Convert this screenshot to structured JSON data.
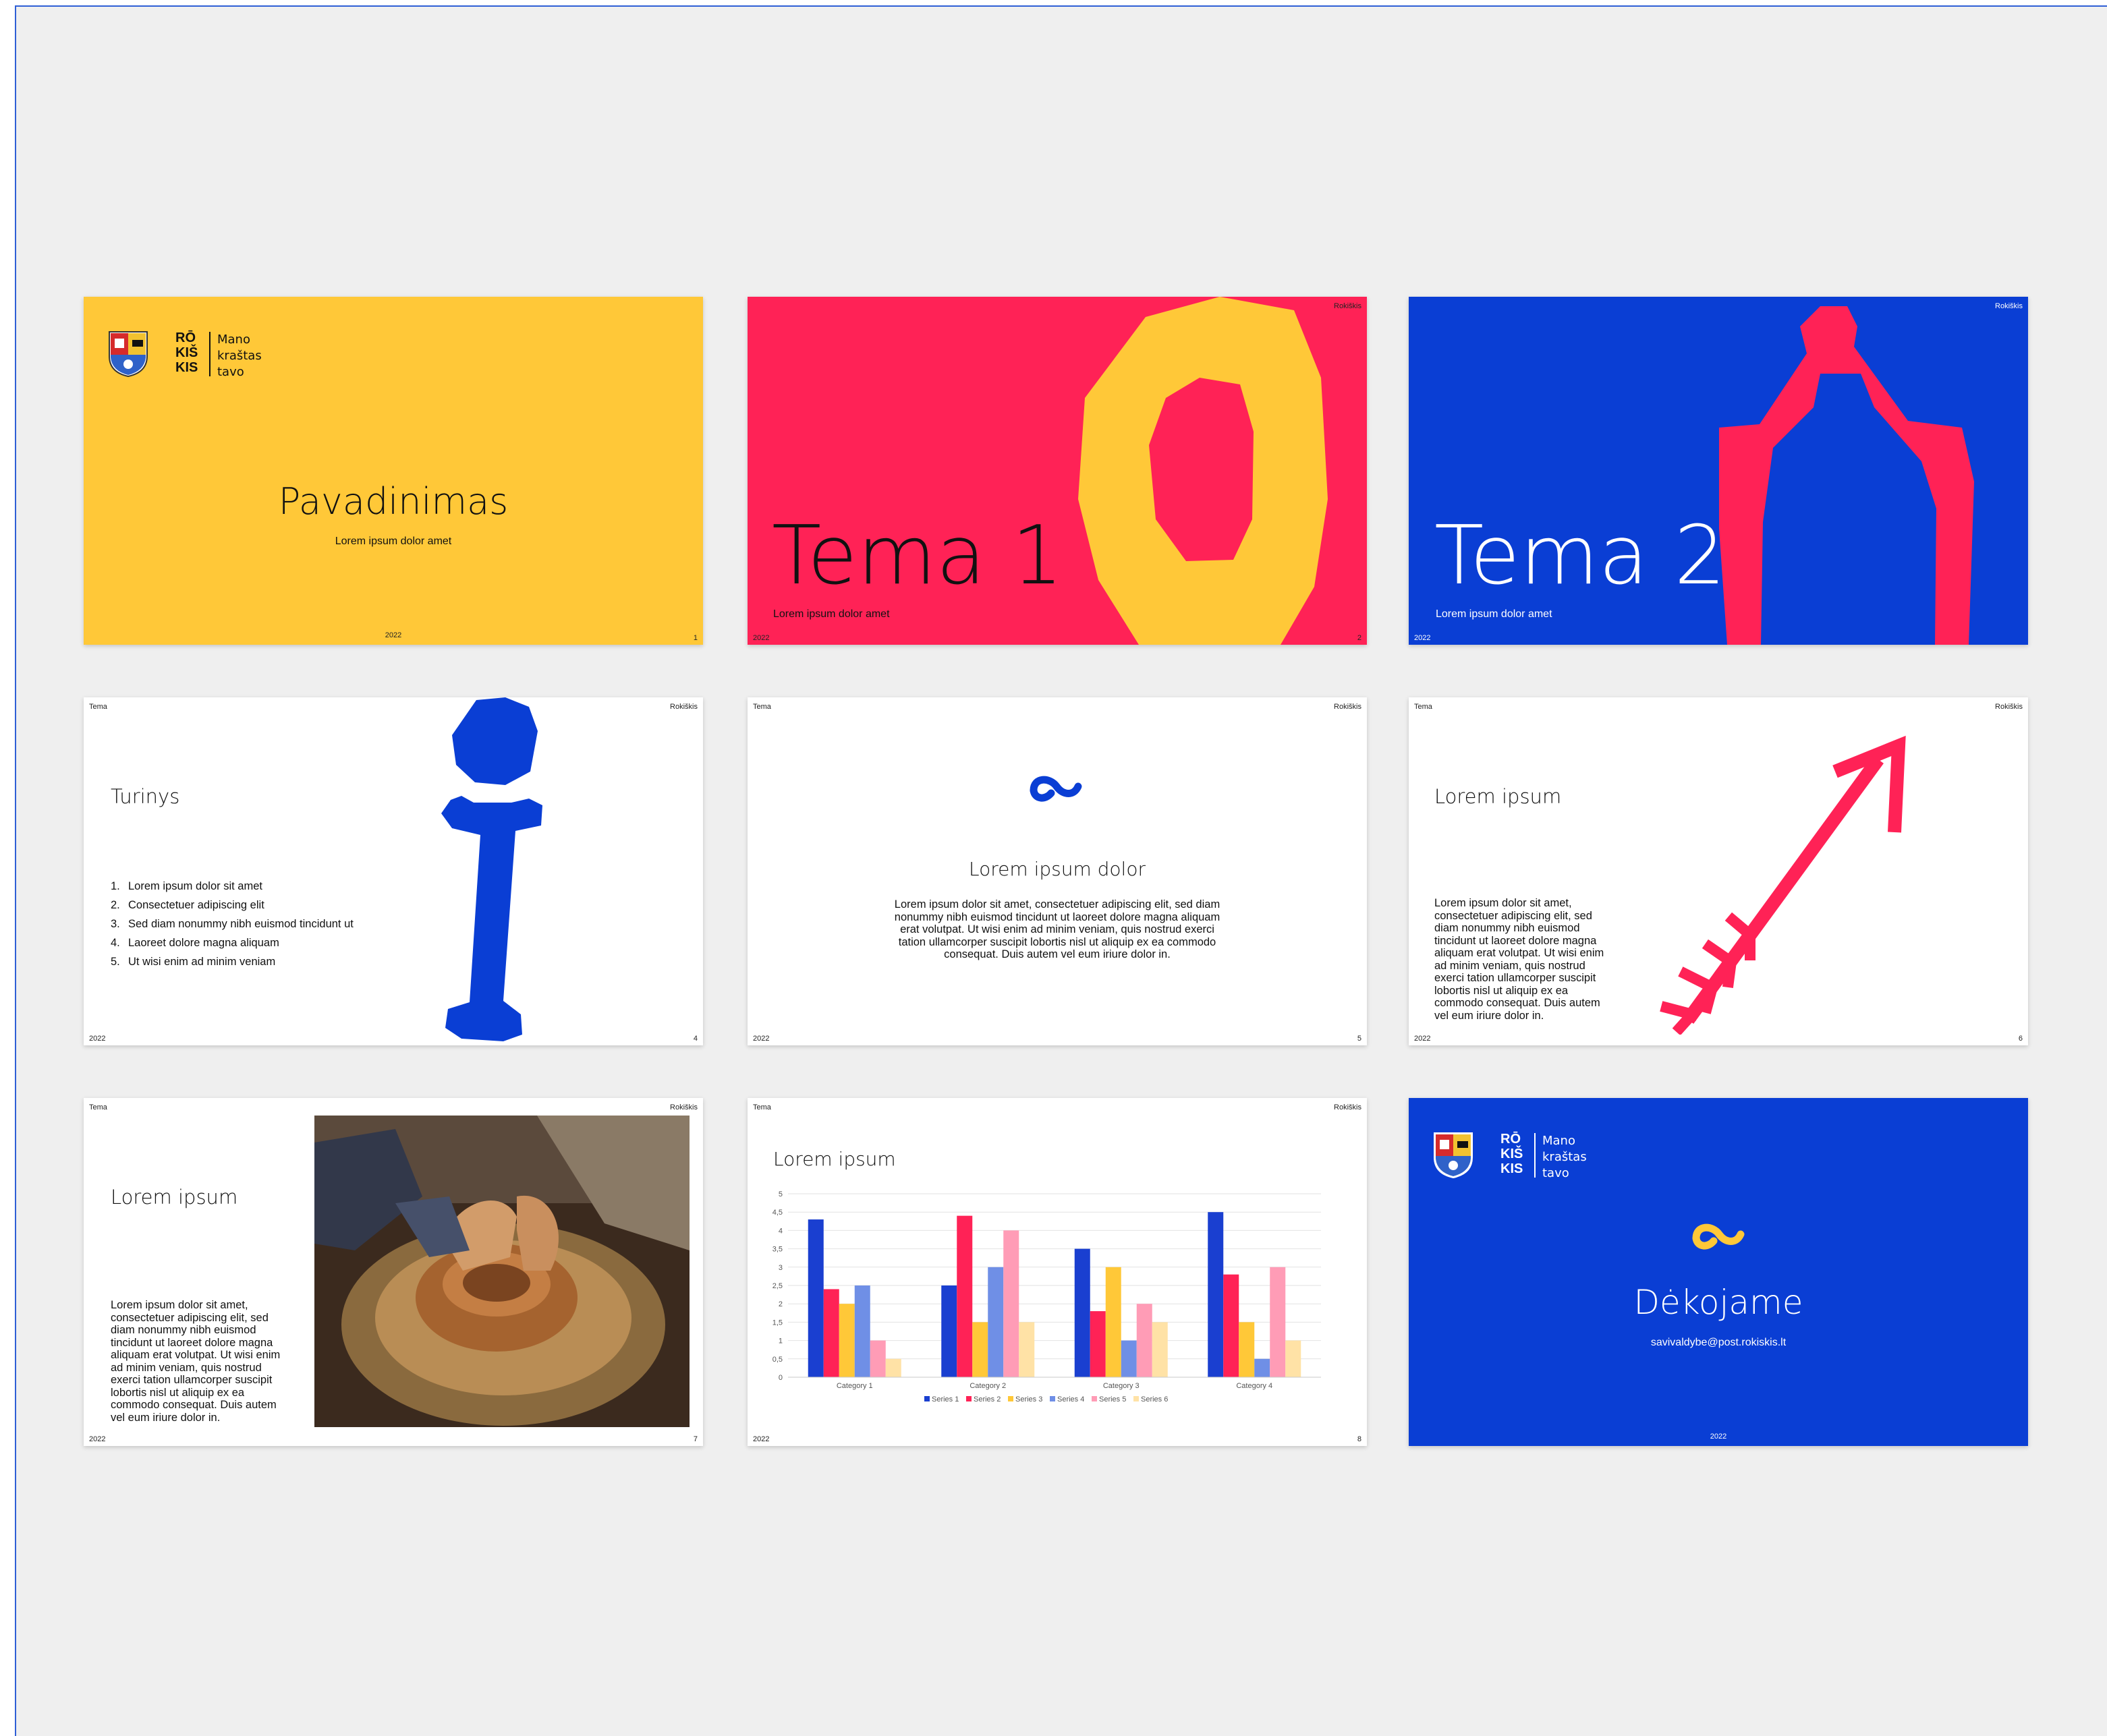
{
  "brand": {
    "name_glyph": "RŌ KIŠ KIS",
    "tagline": [
      "Mano",
      "kraštas",
      "tavo"
    ],
    "corner": "Rokiškis",
    "topic": "Tema",
    "year": "2022",
    "colors": {
      "yellow": "#ffc838",
      "pink": "#ff2256",
      "blue": "#0a3ed4"
    }
  },
  "slides": [
    {
      "number": "1",
      "title": "Pavadinimas",
      "subtitle": "Lorem ipsum dolor amet"
    },
    {
      "number": "2",
      "title": "Tema 1",
      "subtitle": "Lorem ipsum dolor amet",
      "graphic": "letter-o-shape"
    },
    {
      "number": "",
      "title": "Tema 2",
      "subtitle": "Lorem ipsum dolor amet",
      "graphic": "arch-shape"
    },
    {
      "number": "4",
      "title": "Turinys",
      "graphic": "letter-i-shape",
      "list": [
        "Lorem ipsum dolor sit amet",
        "Consectetuer adipiscing elit",
        "Sed diam nonummy nibh euismod tincidunt ut",
        "Laoreet dolore magna aliquam",
        "Ut wisi enim ad minim veniam"
      ]
    },
    {
      "number": "5",
      "title": "Lorem ipsum dolor",
      "graphic": "wave-icon",
      "body": [
        "Lorem ipsum dolor sit amet, consectetuer adipiscing elit, sed diam",
        "nonummy nibh euismod tincidunt ut laoreet dolore magna aliquam",
        "erat volutpat. Ut wisi enim ad minim veniam, quis nostrud exerci",
        "tation ullamcorper suscipit lobortis nisl ut aliquip ex ea commodo",
        "consequat. Duis autem vel eum iriure dolor in."
      ]
    },
    {
      "number": "6",
      "title": "Lorem ipsum",
      "graphic": "arrow-shape",
      "body": [
        "Lorem ipsum dolor sit amet,",
        "consectetuer adipiscing elit, sed",
        "diam nonummy nibh euismod",
        "tincidunt ut laoreet dolore magna",
        "aliquam erat volutpat. Ut wisi enim",
        "ad minim veniam, quis nostrud",
        "exerci tation ullamcorper suscipit",
        "lobortis nisl ut aliquip ex ea",
        "commodo consequat. Duis autem",
        "vel eum iriure dolor in."
      ]
    },
    {
      "number": "7",
      "title": "Lorem ipsum",
      "graphic": "pottery-photo",
      "body": [
        "Lorem ipsum dolor sit amet,",
        "consectetuer adipiscing elit, sed",
        "diam nonummy nibh euismod",
        "tincidunt ut laoreet dolore magna",
        "aliquam erat volutpat. Ut wisi enim",
        "ad minim veniam, quis nostrud",
        "exerci tation ullamcorper suscipit",
        "lobortis nisl ut aliquip ex ea",
        "commodo consequat. Duis autem",
        "vel eum iriure dolor in."
      ]
    },
    {
      "number": "8",
      "title": "Lorem ipsum"
    },
    {
      "number": "",
      "title": "Dėkojame",
      "subtitle": "savivaldybe@post.rokiskis.lt",
      "graphic": "wave-icon"
    }
  ],
  "chart_data": {
    "type": "bar",
    "categories": [
      "Category 1",
      "Category 2",
      "Category 3",
      "Category 4"
    ],
    "series": [
      {
        "name": "Series 1",
        "color": "#1a3fd0",
        "values": [
          4.3,
          2.5,
          3.5,
          4.5
        ]
      },
      {
        "name": "Series 2",
        "color": "#ff2256",
        "values": [
          2.4,
          4.4,
          1.8,
          2.8
        ]
      },
      {
        "name": "Series 3",
        "color": "#ffc838",
        "values": [
          2.0,
          1.5,
          3.0,
          1.5
        ]
      },
      {
        "name": "Series 4",
        "color": "#6f8fe6",
        "values": [
          2.5,
          3.0,
          1.0,
          0.5
        ]
      },
      {
        "name": "Series 5",
        "color": "#ff9cb6",
        "values": [
          1.0,
          4.0,
          2.0,
          3.0
        ]
      },
      {
        "name": "Series 6",
        "color": "#ffe2a6",
        "values": [
          0.5,
          1.5,
          1.5,
          1.0
        ]
      }
    ],
    "yticks": [
      "0",
      "0,5",
      "1",
      "1,5",
      "2",
      "2,5",
      "3",
      "3,5",
      "4",
      "4,5",
      "5"
    ],
    "ylim": [
      0,
      5
    ],
    "grid": true,
    "legend": "bottom"
  }
}
